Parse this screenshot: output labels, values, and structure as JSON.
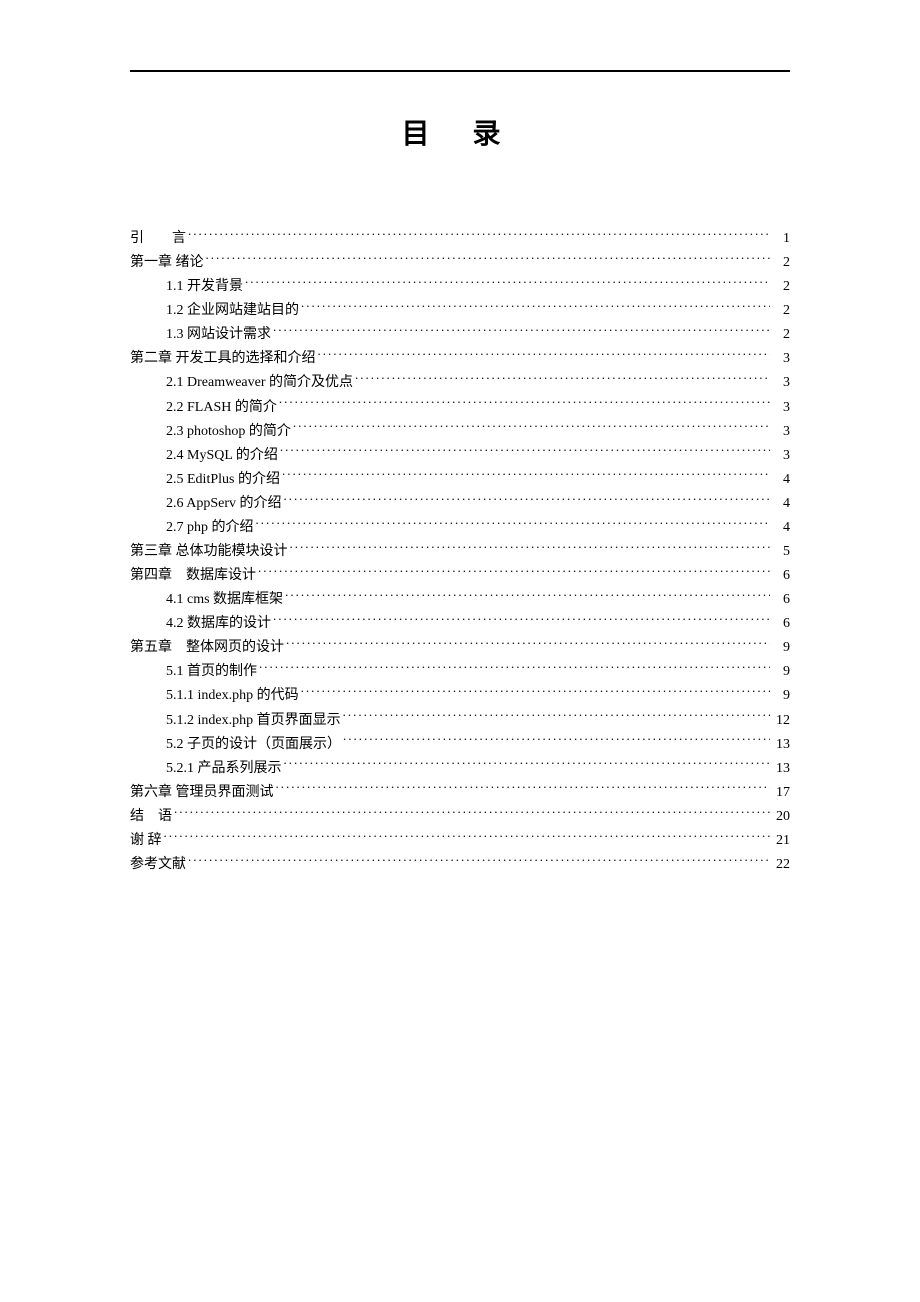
{
  "title": "目 录",
  "entries": [
    {
      "level": 0,
      "label": "引　　言",
      "page": "1",
      "spaced": false
    },
    {
      "level": 0,
      "label": "第一章 绪论",
      "page": "2"
    },
    {
      "level": 1,
      "label": "1.1 开发背景",
      "page": "2"
    },
    {
      "level": 1,
      "label": "1.2 企业网站建站目的",
      "page": "2"
    },
    {
      "level": 1,
      "label": "1.3 网站设计需求",
      "page": "2"
    },
    {
      "level": 0,
      "label": "第二章 开发工具的选择和介绍",
      "page": "3"
    },
    {
      "level": 1,
      "label": "2.1 Dreamweaver 的简介及优点",
      "page": "3"
    },
    {
      "level": 1,
      "label": "2.2 FLASH 的简介",
      "page": "3"
    },
    {
      "level": 1,
      "label": "2.3 photoshop 的简介",
      "page": "3"
    },
    {
      "level": 1,
      "label": "2.4 MySQL 的介绍",
      "page": "3"
    },
    {
      "level": 1,
      "label": "2.5 EditPlus 的介绍",
      "page": "4"
    },
    {
      "level": 1,
      "label": "2.6 AppServ 的介绍",
      "page": "4"
    },
    {
      "level": 1,
      "label": "2.7 php 的介绍",
      "page": "4"
    },
    {
      "level": 0,
      "label": "第三章 总体功能模块设计",
      "page": "5"
    },
    {
      "level": 0,
      "label": "第四章　数据库设计",
      "page": "6"
    },
    {
      "level": 1,
      "label": "4.1 cms 数据库框架",
      "page": "6"
    },
    {
      "level": 1,
      "label": "4.2 数据库的设计",
      "page": "6"
    },
    {
      "level": 0,
      "label": "第五章　整体网页的设计",
      "page": "9"
    },
    {
      "level": 1,
      "label": "5.1 首页的制作",
      "page": "9"
    },
    {
      "level": 1,
      "label": "5.1.1 index.php 的代码",
      "page": "9"
    },
    {
      "level": 1,
      "label": "5.1.2 index.php 首页界面显示",
      "page": "12"
    },
    {
      "level": 1,
      "label": "5.2 子页的设计（页面展示）",
      "page": "13"
    },
    {
      "level": 1,
      "label": "5.2.1 产品系列展示",
      "page": "13"
    },
    {
      "level": 0,
      "label": "第六章 管理员界面测试",
      "page": "17"
    },
    {
      "level": 0,
      "label": "结　语",
      "page": "20"
    },
    {
      "level": 0,
      "label": "谢 辞",
      "page": "21"
    },
    {
      "level": 0,
      "label": "参考文献",
      "page": "22"
    }
  ]
}
